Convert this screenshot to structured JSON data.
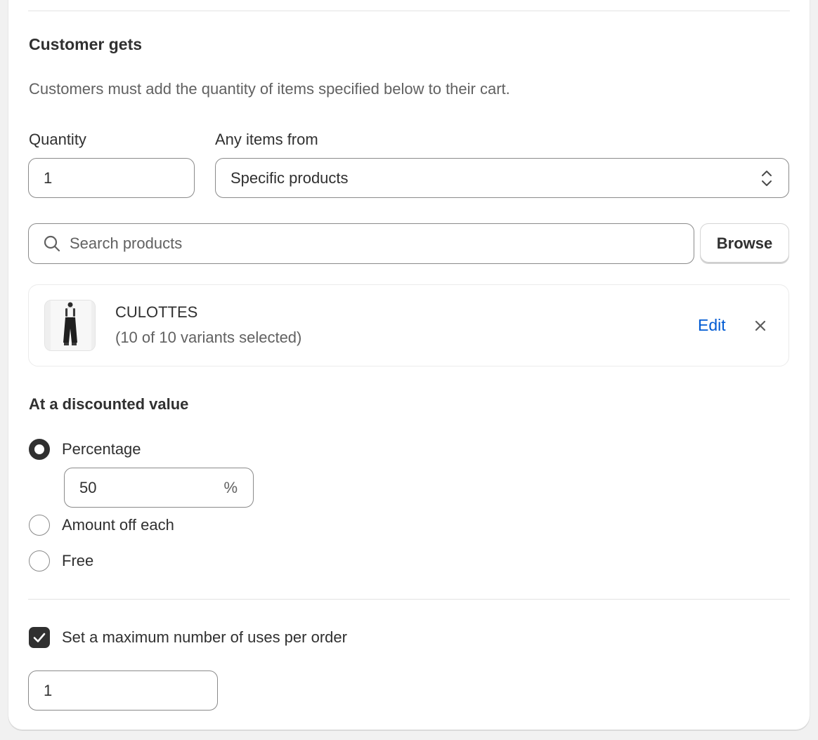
{
  "section": {
    "title": "Customer gets",
    "description": "Customers must add the quantity of items specified below to their cart."
  },
  "quantity": {
    "label": "Quantity",
    "value": "1"
  },
  "items_from": {
    "label": "Any items from",
    "selected": "Specific products"
  },
  "search": {
    "placeholder": "Search products",
    "browse_label": "Browse"
  },
  "product": {
    "name": "CULOTTES",
    "variants": "(10 of 10 variants selected)",
    "edit_label": "Edit"
  },
  "discount": {
    "title": "At a discounted value",
    "options": [
      {
        "label": "Percentage",
        "checked": true
      },
      {
        "label": "Amount off each",
        "checked": false
      },
      {
        "label": "Free",
        "checked": false
      }
    ],
    "percentage_value": "50",
    "percentage_suffix": "%"
  },
  "max_uses": {
    "label": "Set a maximum number of uses per order",
    "checked": true,
    "value": "1"
  },
  "colors": {
    "link": "#005bd3",
    "text": "#303030",
    "subdued": "#616161",
    "border": "#8a8a8a"
  }
}
